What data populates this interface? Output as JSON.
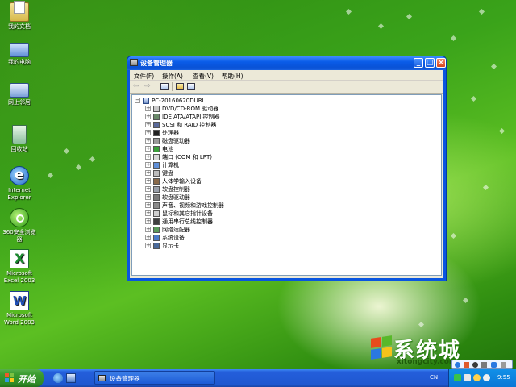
{
  "desktop": {
    "icons": [
      {
        "label": "我的文档"
      },
      {
        "label": "我的电脑"
      },
      {
        "label": "网上邻居"
      },
      {
        "label": "回收站"
      },
      {
        "label": "Internet\nExplorer"
      },
      {
        "label": "360安全浏览\n器"
      },
      {
        "label": "Microsoft\nExcel 2003"
      },
      {
        "label": "Microsoft\nWord 2003"
      }
    ]
  },
  "window": {
    "title": "设备管理器",
    "menu": [
      "文件(F)",
      "操作(A)",
      "查看(V)",
      "帮助(H)"
    ],
    "tree": {
      "root": "PC-20160620DURI",
      "items": [
        "DVD/CD-ROM 驱动器",
        "IDE ATA/ATAPI 控制器",
        "SCSI 和 RAID 控制器",
        "处理器",
        "磁盘驱动器",
        "电池",
        "端口 (COM 和 LPT)",
        "计算机",
        "键盘",
        "人体学输入设备",
        "软盘控制器",
        "软盘驱动器",
        "声音、视频和游戏控制器",
        "鼠标和其它指针设备",
        "通用串行总线控制器",
        "网络适配器",
        "系统设备",
        "显示卡"
      ]
    }
  },
  "taskbar": {
    "start_label": "开始",
    "task_button_label": "设备管理器",
    "language": "CN",
    "clock": "9:55"
  },
  "watermark": {
    "brand": "系统城",
    "site": "xitongcity.com"
  },
  "colors": {
    "taskbar": "#245edb",
    "start_button": "#3a9a2e",
    "title_bar": "#0a5ce8",
    "window_face": "#ece9d8"
  }
}
